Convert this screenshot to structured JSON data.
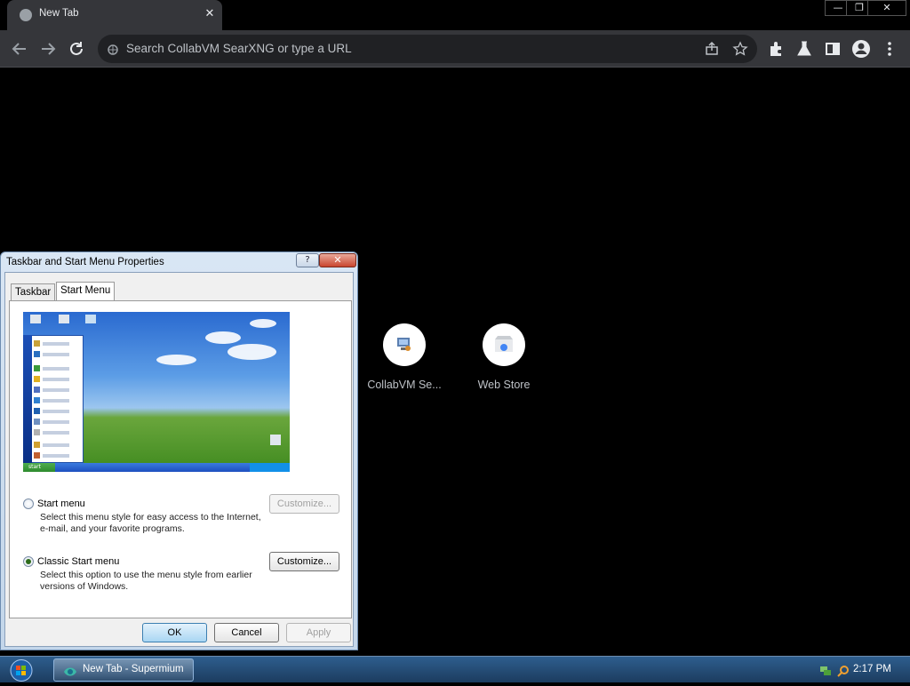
{
  "browser": {
    "tab_title": "New Tab",
    "tab_close": "✕",
    "window_min": "—",
    "window_restore": "❐",
    "window_close": "✕",
    "omnibox_placeholder": "Search CollabVM SearXNG or type a URL",
    "icons": [
      "back-icon",
      "forward-icon",
      "reload-icon",
      "share-icon",
      "star-icon",
      "extensions-icon",
      "labs-icon",
      "side-panel-icon",
      "profile-icon",
      "menu-icon"
    ]
  },
  "shortcuts": [
    {
      "label": "CollabVM Se..."
    },
    {
      "label": "Web Store"
    }
  ],
  "dialog": {
    "title": "Taskbar and Start Menu Properties",
    "help_glyph": "?",
    "close_glyph": "✕",
    "tabs": [
      "Taskbar",
      "Start Menu"
    ],
    "active_tab": "Start Menu",
    "preview_start": "start",
    "options": [
      {
        "label": "Start menu",
        "description": "Select this menu style for easy access to the Internet, e-mail, and your favorite programs.",
        "selected": false,
        "customize_label": "Customize...",
        "customize_enabled": false
      },
      {
        "label": "Classic Start menu",
        "description": "Select this option to use the menu style from earlier versions of Windows.",
        "selected": true,
        "customize_label": "Customize...",
        "customize_enabled": true
      }
    ],
    "buttons": {
      "ok": "OK",
      "cancel": "Cancel",
      "apply": "Apply"
    }
  },
  "taskbar": {
    "task_label": "New Tab - Supermium",
    "clock": "2:17 PM"
  },
  "colors": {
    "browser_bg": "#000000",
    "toolbar": "#35363a",
    "omnibox": "#202124",
    "taskbar": "#1c3c5f"
  }
}
